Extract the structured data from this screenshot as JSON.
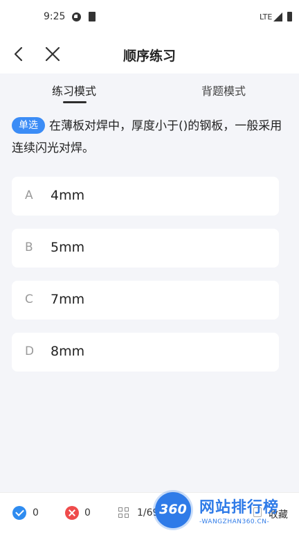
{
  "status_bar": {
    "time": "9:25",
    "network": "LTE"
  },
  "nav": {
    "title": "顺序练习"
  },
  "tabs": [
    {
      "label": "练习模式",
      "active": true
    },
    {
      "label": "背题模式",
      "active": false
    }
  ],
  "question": {
    "type": "单选",
    "text": "在薄板对焊中，厚度小于()的钢板，一般采用连续闪光对焊。"
  },
  "options": [
    {
      "letter": "A",
      "text": "4mm"
    },
    {
      "letter": "B",
      "text": "5mm"
    },
    {
      "letter": "C",
      "text": "7mm"
    },
    {
      "letter": "D",
      "text": "8mm"
    }
  ],
  "bottom_bar": {
    "correct_count": "0",
    "wrong_count": "0",
    "progress": "1/694",
    "collect_label": "收藏"
  },
  "watermark": {
    "badge": "360",
    "name": "网站排行榜",
    "url": "-WANGZHAN360.CN-"
  },
  "colors": {
    "accent": "#3b8cf6",
    "correct": "#2f8cf0",
    "wrong": "#ef4b4b",
    "background": "#f4f5f9"
  }
}
